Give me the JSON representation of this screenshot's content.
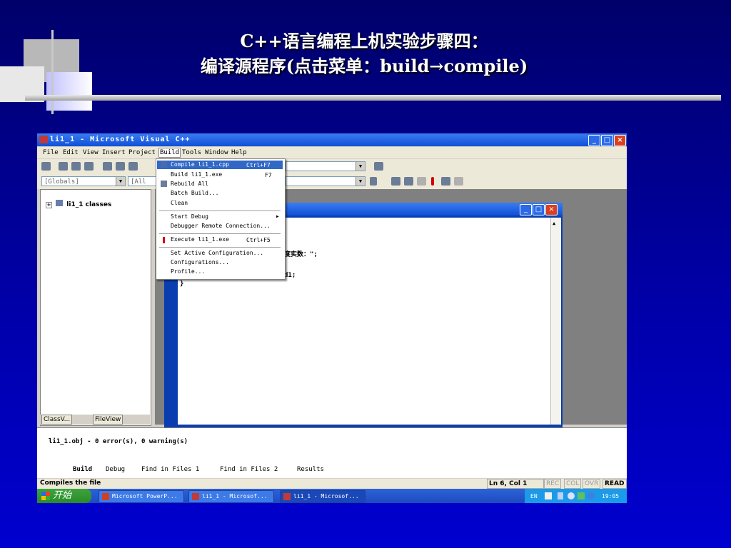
{
  "slide": {
    "title_line1": "C++语言编程上机实验步骤四：",
    "title_line2": "编译源程序(点击菜单：build→compile)"
  },
  "window": {
    "title": "li1_1 - Microsoft Visual C++",
    "controls": {
      "minimize": "_",
      "maximize": "□",
      "close": "×"
    }
  },
  "menubar": [
    "File",
    "Edit",
    "View",
    "Insert",
    "Project",
    "Build",
    "Tools",
    "Window",
    "Help"
  ],
  "toolbar": {
    "globals_combo": "[Globals]",
    "members_combo": "[All glo"
  },
  "workspace": {
    "tree_root": "li1_1 classes",
    "tabs": [
      "ClassV...",
      "FileView"
    ]
  },
  "build_menu": {
    "items": [
      {
        "label": "Compile li1_1.cpp",
        "shortcut": "Ctrl+F7",
        "selected": true
      },
      {
        "label": "Build li1_1.exe",
        "shortcut": "F7"
      },
      {
        "label": "Rebuild All",
        "shortcut": ""
      },
      {
        "label": "Batch Build...",
        "shortcut": ""
      },
      {
        "label": "Clean",
        "shortcut": ""
      },
      {
        "label": "Start Debug",
        "shortcut": "▶"
      },
      {
        "label": "Debugger Remote Connection...",
        "shortcut": ""
      },
      {
        "label": "Execute li1_1.exe",
        "shortcut": "Ctrl+F5"
      },
      {
        "label": "Set Active Configuration...",
        "shortcut": ""
      },
      {
        "label": "Configurations...",
        "shortcut": ""
      },
      {
        "label": "Profile...",
        "shortcut": ""
      }
    ]
  },
  "editor": {
    "code_fragments": [
      "度实数：\";",
      "d1;",
      "}"
    ]
  },
  "output": {
    "message": "li1_1.obj - 0 error(s), 0 warning(s)",
    "tabs": [
      "Build",
      "Debug",
      "Find in Files 1",
      "Find in Files 2",
      "Results"
    ]
  },
  "statusbar": {
    "message": "Compiles the file",
    "position": "Ln 6, Col 1",
    "indicators": [
      "REC",
      "COL",
      "OVR",
      "READ"
    ]
  },
  "taskbar": {
    "start": "开始",
    "tasks": [
      "Microsoft PowerP...",
      "li1_1 - Microsof...",
      "li1_1 - Microsof..."
    ],
    "lang": "EN",
    "clock": "19:05"
  },
  "colors": {
    "background": "#0000a8",
    "menu_selection": "#3168c6",
    "title_bar": "#1050d8"
  }
}
